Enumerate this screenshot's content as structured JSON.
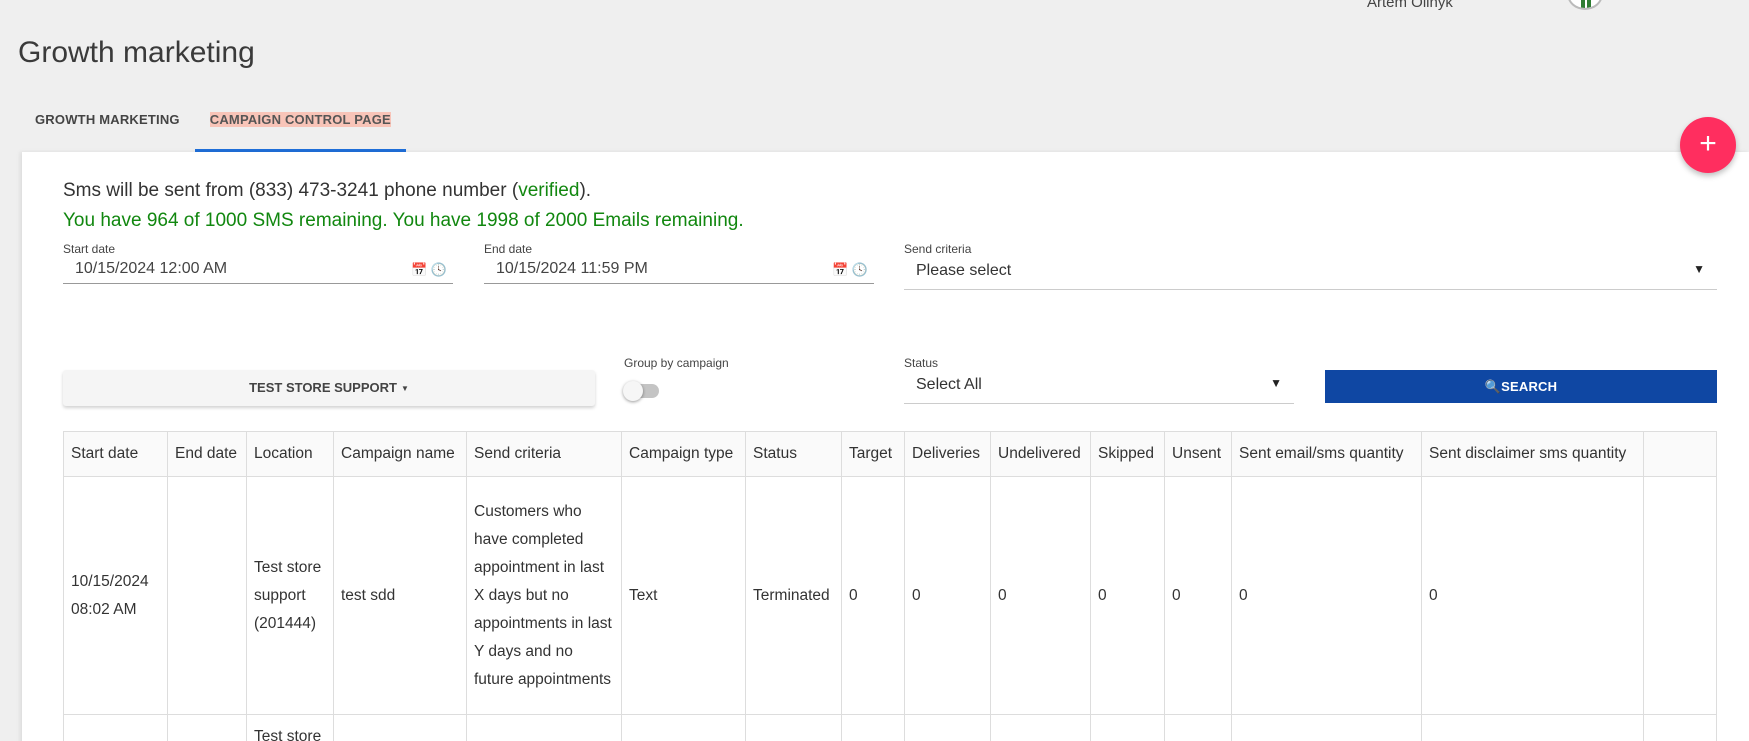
{
  "header": {
    "user_name": "Artem Olinyk",
    "page_title": "Growth marketing"
  },
  "tabs": [
    {
      "label": "GROWTH MARKETING",
      "active": false
    },
    {
      "label": "CAMPAIGN CONTROL PAGE",
      "active": true
    }
  ],
  "fab": {
    "label": "+"
  },
  "info": {
    "sms_prefix": "Sms will be sent from (833) 473-3241 phone number (",
    "sms_verified": "verified",
    "sms_suffix": ").",
    "remaining": "You have 964 of 1000 SMS remaining. You have 1998 of 2000 Emails remaining."
  },
  "filters": {
    "start_date_label": "Start date",
    "start_date_value": "10/15/2024 12:00 AM",
    "end_date_label": "End date",
    "end_date_value": "10/15/2024 11:59 PM",
    "send_criteria_label": "Send criteria",
    "send_criteria_value": "Please select",
    "store_button_label": "TEST STORE SUPPORT",
    "group_by_label": "Group by campaign",
    "group_by_on": false,
    "status_label": "Status",
    "status_value": "Select All",
    "search_label": "SEARCH"
  },
  "table": {
    "columns": [
      "Start date",
      "End date",
      "Location",
      "Campaign name",
      "Send criteria",
      "Campaign type",
      "Status",
      "Target",
      "Deliveries",
      "Undelivered",
      "Skipped",
      "Unsent",
      "Sent email/sms quantity",
      "Sent disclaimer sms quantity",
      ""
    ],
    "rows": [
      {
        "start_date": "10/15/2024 08:02 AM",
        "end_date": "",
        "location": "Test store support (201444)",
        "campaign_name": "test sdd",
        "send_criteria": "Customers who have completed appointment in last X days but no appointments in last Y days and no future appointments",
        "campaign_type": "Text",
        "status": "Terminated",
        "target": "0",
        "deliveries": "0",
        "undelivered": "0",
        "skipped": "0",
        "unsent": "0",
        "sent_quantity": "0",
        "sent_disclaimer": "0"
      },
      {
        "start_date": "",
        "end_date": "",
        "location": "Test store",
        "campaign_name": "",
        "send_criteria": "",
        "campaign_type": "",
        "status": "",
        "target": "",
        "deliveries": "",
        "undelivered": "",
        "skipped": "",
        "unsent": "",
        "sent_quantity": "",
        "sent_disclaimer": ""
      }
    ]
  },
  "colors": {
    "accent_tab_underline": "#1f6fd9",
    "search_button": "#0f47a3",
    "fab": "#ff2e5f",
    "success_text": "#11870f"
  }
}
